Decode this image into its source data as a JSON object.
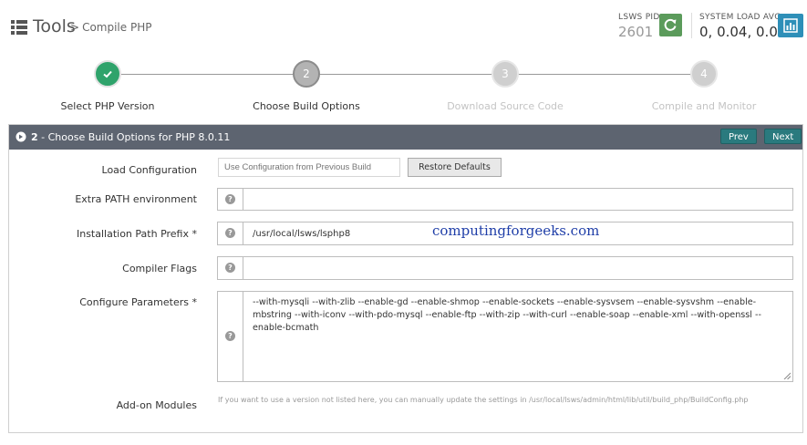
{
  "header": {
    "title": "Tools",
    "breadcrumb_sep": ">",
    "breadcrumb": "Compile PHP",
    "lsws_pid_label": "LSWS PID",
    "lsws_pid_value": "2601",
    "system_load_label": "SYSTEM LOAD AVG",
    "system_load_value": "0, 0.04, 0.02"
  },
  "steps": [
    {
      "number": "",
      "label": "Select PHP Version",
      "state": "done"
    },
    {
      "number": "2",
      "label": "Choose Build Options",
      "state": "active"
    },
    {
      "number": "3",
      "label": "Download Source Code",
      "state": "todo"
    },
    {
      "number": "4",
      "label": "Compile and Monitor",
      "state": "todo"
    }
  ],
  "panel": {
    "step_num": "2",
    "title": " - Choose Build Options for PHP 8.0.11",
    "prev_label": "Prev",
    "next_label": "Next"
  },
  "form": {
    "load_config_label": "Load Configuration",
    "load_config_placeholder": "Use Configuration from Previous Build",
    "restore_label": "Restore Defaults",
    "extra_path_label": "Extra PATH environment",
    "extra_path_value": "",
    "install_prefix_label": "Installation Path Prefix *",
    "install_prefix_value": "/usr/local/lsws/lsphp8",
    "compiler_flags_label": "Compiler Flags",
    "compiler_flags_value": "",
    "configure_label": "Configure Parameters *",
    "configure_value": "--with-mysqli --with-zlib --enable-gd --enable-shmop --enable-sockets --enable-sysvsem --enable-sysvshm --enable-mbstring --with-iconv --with-pdo-mysql --enable-ftp --with-zip --with-curl --enable-soap --enable-xml --with-openssl --enable-bcmath",
    "addon_label": "Add-on Modules",
    "addon_hint": "If you want to use a version not listed here, you can manually update the settings in /usr/local/lsws/admin/html/lib/util/build_php/BuildConfig.php",
    "help_glyph": "?"
  },
  "watermark": "computingforgeeks.com",
  "colors": {
    "panel_header": "#5d6470",
    "accent_button": "#2a7a7e",
    "done_step": "#2fa36b",
    "reload_button": "#5b9b5b",
    "chart_button": "#2e8fb8"
  },
  "icons": {
    "tools": "list-icon",
    "reload": "refresh-icon",
    "chart": "bar-chart-icon",
    "panel": "arrow-circle-right-icon",
    "done": "check-icon",
    "help": "question-circle-icon"
  }
}
